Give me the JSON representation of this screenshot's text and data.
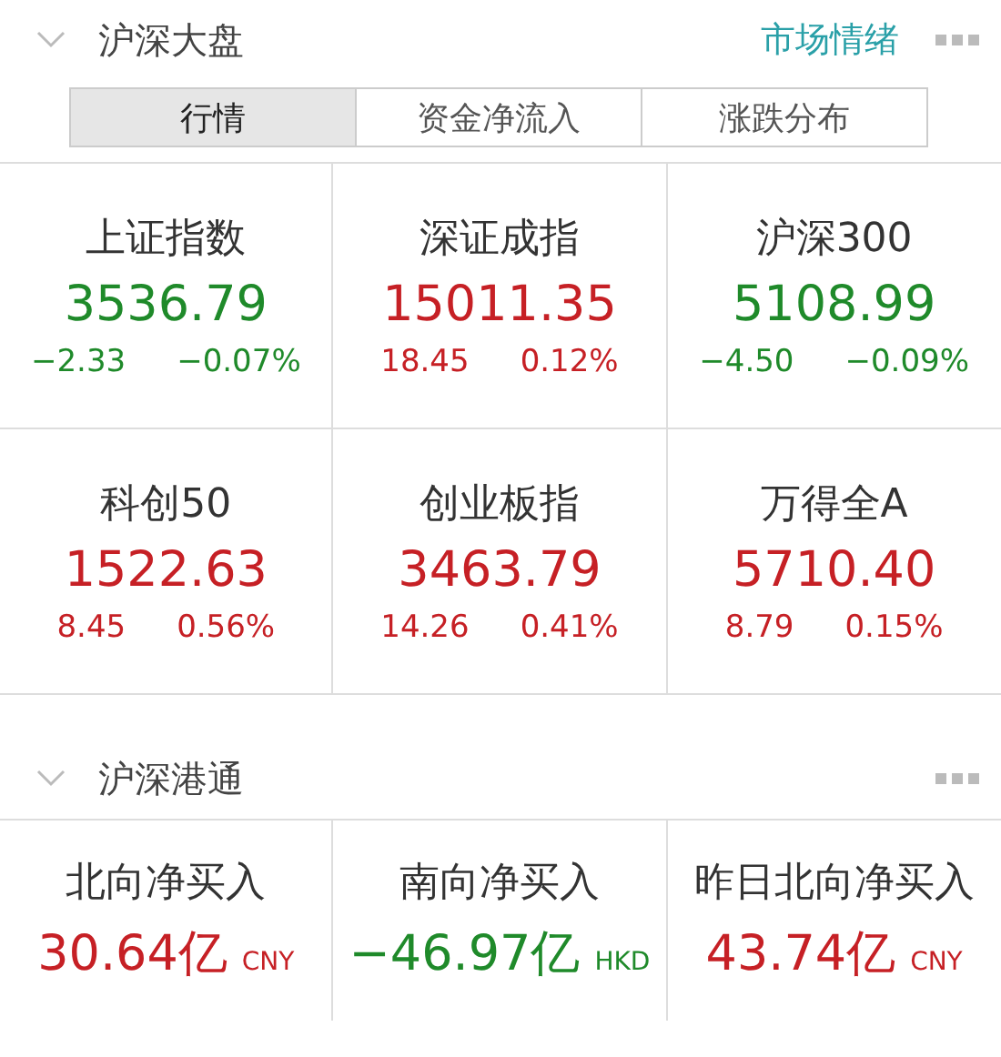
{
  "market": {
    "title": "沪深大盘",
    "expanded": true,
    "link": "市场情绪",
    "tabs": [
      {
        "label": "行情",
        "selected": true
      },
      {
        "label": "资金净流入",
        "selected": false
      },
      {
        "label": "涨跌分布",
        "selected": false
      }
    ],
    "cards": [
      {
        "name": "上证指数",
        "value": "3536.79",
        "rising": false,
        "change": "−2.33",
        "percent": "−0.07%"
      },
      {
        "name": "深证成指",
        "value": "15011.35",
        "rising": true,
        "change": "18.45",
        "percent": "0.12%"
      },
      {
        "name": "沪深300",
        "value": "5108.99",
        "rising": false,
        "change": "−4.50",
        "percent": "−0.09%"
      },
      {
        "name": "科创50",
        "value": "1522.63",
        "rising": true,
        "change": "8.45",
        "percent": "0.56%"
      },
      {
        "name": "创业板指",
        "value": "3463.79",
        "rising": true,
        "change": "14.26",
        "percent": "0.41%"
      },
      {
        "name": "万得全A",
        "value": "5710.40",
        "rising": true,
        "change": "8.79",
        "percent": "0.15%"
      }
    ]
  },
  "connect": {
    "title": "沪深港通",
    "expanded": true,
    "cards": [
      {
        "name": "北向净买入",
        "value": "30.64亿",
        "rising": true,
        "unit": "CNY"
      },
      {
        "name": "南向净买入",
        "value": "−46.97亿",
        "rising": false,
        "unit": "HKD"
      },
      {
        "name": "昨日北向净买入",
        "value": "43.74亿",
        "rising": true,
        "unit": "CNY"
      }
    ]
  }
}
